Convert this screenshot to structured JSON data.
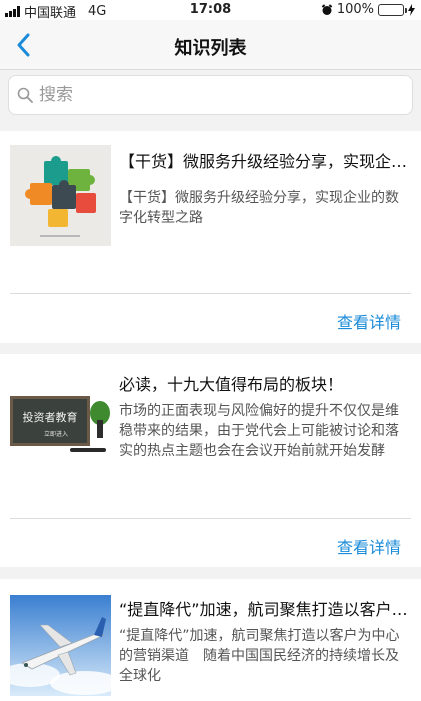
{
  "status_bar": {
    "carrier": "中国联通",
    "network": "4G",
    "time": "17:08",
    "battery": "100%",
    "battery_level": 1.0
  },
  "nav": {
    "title": "知识列表",
    "back_icon": "chevron-left-icon"
  },
  "search": {
    "placeholder": "搜索",
    "value": ""
  },
  "colors": {
    "accent": "#1a8bd8",
    "background": "#f2f2f2"
  },
  "articles": [
    {
      "title": "【干货】微服务升级经验分享，实现企业的数字化转型之路",
      "summary": "【干货】微服务升级经验分享，实现企业的数字化转型之路",
      "action": "查看详情",
      "thumbnail": "puzzle-image"
    },
    {
      "title": "必读，十九大值得布局的板块！",
      "summary": "市场的正面表现与风险偏好的提升不仅仅是维稳带来的结果，由于党代会上可能被讨论和落实的热点主题也会在会议开始前就开始发酵",
      "action": "查看详情",
      "thumbnail": "blackboard-image",
      "thumbnail_text": "投资者教育",
      "thumbnail_subtext": "立即进入"
    },
    {
      "title": "“提直降代”加速，航司聚焦打造以客户为中心的营销渠道",
      "summary": "“提直降代”加速，航司聚焦打造以客户为中心的营销渠道　随着中国国民经济的持续增长及全球化",
      "action": "查看详情",
      "thumbnail": "airplane-image"
    }
  ]
}
